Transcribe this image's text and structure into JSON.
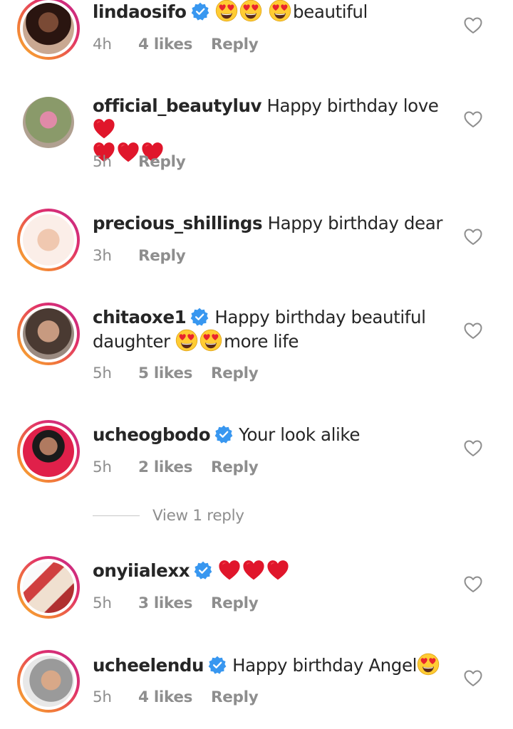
{
  "comments": [
    {
      "username": "lindaosifo",
      "verified": true,
      "text_after": "beautiful",
      "time": "4h",
      "likes": "4 likes",
      "reply": "Reply"
    },
    {
      "username": "official_beautyluv",
      "verified": false,
      "text": "Happy birthday love",
      "time": "5h",
      "likes": "",
      "reply": "Reply"
    },
    {
      "username": "precious_shillings",
      "verified": false,
      "text": "Happy birthday dear",
      "time": "3h",
      "likes": "",
      "reply": "Reply"
    },
    {
      "username": "chitaoxe1",
      "verified": true,
      "text": "Happy birthday beautiful",
      "text_line2_word": "daughter",
      "text_after": "more life",
      "time": "5h",
      "likes": "5 likes",
      "reply": "Reply"
    },
    {
      "username": "ucheogbodo",
      "verified": true,
      "text": "Your look alike",
      "time": "5h",
      "likes": "2 likes",
      "reply": "Reply"
    },
    {
      "username": "onyiialexx",
      "verified": true,
      "time": "5h",
      "likes": "3 likes",
      "reply": "Reply"
    },
    {
      "username": "ucheelendu",
      "verified": true,
      "text": "Happy birthday Angel",
      "time": "5h",
      "likes": "4 likes",
      "reply": "Reply"
    }
  ],
  "view_replies": "View 1 reply",
  "icons": {
    "verified": "verified-badge-icon",
    "like": "heart-outline-icon",
    "heart_eyes": "heart-eyes-emoji",
    "red_heart": "red-heart-emoji"
  },
  "colors": {
    "verified_blue": "#3897f0",
    "muted_text": "#8e8e8e",
    "primary_text": "#262626",
    "red_heart": "#e0162b",
    "emoji_yellow": "#ffcc33"
  }
}
